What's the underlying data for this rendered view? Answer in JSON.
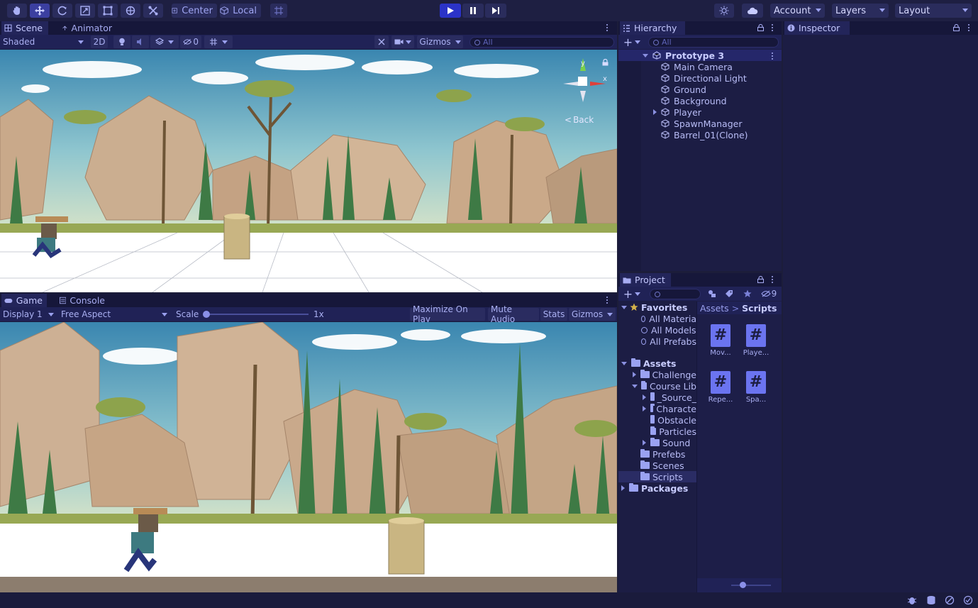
{
  "toolbar": {
    "tools": [
      {
        "name": "hand-tool"
      },
      {
        "name": "move-tool"
      },
      {
        "name": "rotate-tool"
      },
      {
        "name": "scale-tool"
      },
      {
        "name": "rect-tool"
      },
      {
        "name": "transform-tool"
      },
      {
        "name": "custom-tools"
      }
    ],
    "pivot_label": "Center",
    "space_label": "Local",
    "account_label": "Account",
    "layers_label": "Layers",
    "layout_label": "Layout"
  },
  "scene": {
    "tabs": [
      {
        "label": "Scene"
      },
      {
        "label": "Animator"
      }
    ],
    "shading": "Shaded",
    "mode_2d": "2D",
    "hidden_count": "0",
    "gizmos_label": "Gizmos",
    "search_placeholder": "All",
    "gizmo_back_label": "Back",
    "axis_y": "y",
    "axis_x": "x"
  },
  "game": {
    "tabs": [
      {
        "label": "Game"
      },
      {
        "label": "Console"
      }
    ],
    "display": "Display 1",
    "aspect": "Free Aspect",
    "scale_label": "Scale",
    "scale_value": "1x",
    "maximize_label": "Maximize On Play",
    "mute_label": "Mute Audio",
    "stats_label": "Stats",
    "gizmos_label": "Gizmos"
  },
  "hierarchy": {
    "tab_label": "Hierarchy",
    "search_placeholder": "All",
    "scene_name": "Prototype 3",
    "objects": [
      {
        "label": "Main Camera",
        "has_children": false
      },
      {
        "label": "Directional Light",
        "has_children": false
      },
      {
        "label": "Ground",
        "has_children": false
      },
      {
        "label": "Background",
        "has_children": false
      },
      {
        "label": "Player",
        "has_children": true
      },
      {
        "label": "SpawnManager",
        "has_children": false
      },
      {
        "label": "Barrel_01(Clone)",
        "has_children": false
      }
    ]
  },
  "project": {
    "tab_label": "Project",
    "hidden_count": "9",
    "favorites_label": "Favorites",
    "favorites": [
      "All Materia",
      "All Models",
      "All Prefabs"
    ],
    "assets_label": "Assets",
    "tree": [
      {
        "label": "Challenge",
        "depth": 1,
        "arrow": "right"
      },
      {
        "label": "Course Lib",
        "depth": 1,
        "arrow": "down"
      },
      {
        "label": "_Source_",
        "depth": 2,
        "arrow": "right"
      },
      {
        "label": "Characte",
        "depth": 2,
        "arrow": "right"
      },
      {
        "label": "Obstacle",
        "depth": 2,
        "arrow": "none"
      },
      {
        "label": "Particles",
        "depth": 2,
        "arrow": "none"
      },
      {
        "label": "Sound",
        "depth": 2,
        "arrow": "right"
      },
      {
        "label": "Prefebs",
        "depth": 1,
        "arrow": "none"
      },
      {
        "label": "Scenes",
        "depth": 1,
        "arrow": "none"
      },
      {
        "label": "Scripts",
        "depth": 1,
        "arrow": "none",
        "selected": true
      }
    ],
    "packages_label": "Packages",
    "breadcrumb": [
      "Assets",
      "Scripts"
    ],
    "scripts": [
      {
        "label": "Mov..."
      },
      {
        "label": "Playe..."
      },
      {
        "label": "Repe..."
      },
      {
        "label": "Spa..."
      }
    ],
    "script_glyph": "#"
  },
  "inspector": {
    "tab_label": "Inspector"
  },
  "colors": {
    "accent": "#3b3fa0",
    "background": "#1c1d3a",
    "sky_top": "#3f8fb6",
    "ground": "#ffffff"
  }
}
